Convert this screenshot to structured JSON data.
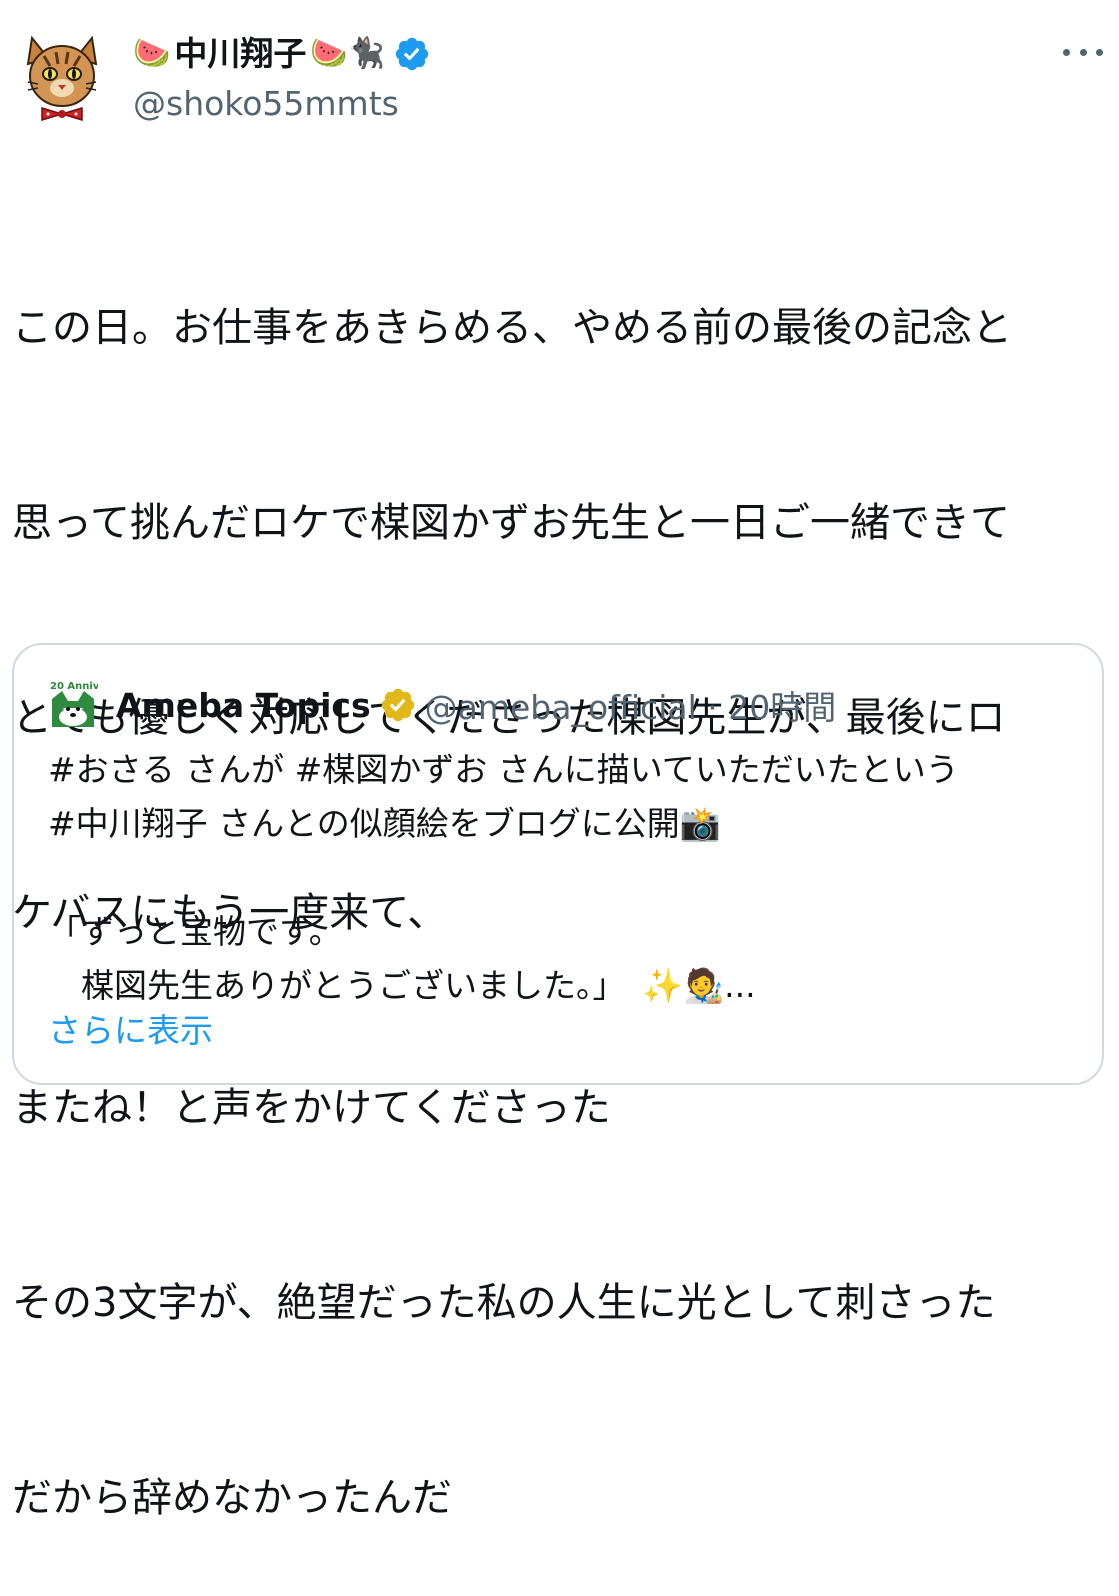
{
  "author": {
    "display_name": "中川翔子",
    "name_prefix_emoji": "🍉",
    "name_suffix_emoji": "🍉🐈‍⬛",
    "handle": "@shoko55mmts",
    "verified_badge_color": "#1d9bf0"
  },
  "tweet": {
    "lines": [
      "この日。お仕事をあきらめる、やめる前の最後の記念と",
      "思って挑んだロケで楳図かずお先生と一日ご一緒できて",
      "とても優しく対応してくださった楳図先生が、最後にロ",
      "ケバスにもう一度来て、",
      "またね！と声をかけてくださった",
      "その3文字が、絶望だった私の人生に光として刺さった",
      "だから辞めなかったんだ"
    ]
  },
  "quote": {
    "display_name": "Ameba Topics",
    "handle_time": "@ameba_official · 20時間",
    "avatar_label": "20 Anniv.",
    "badge_color": "#e2b719",
    "lines": [
      "#おさる さんが #楳図かずお さんに描いていただいたという",
      "#中川翔子 さんとの似顔絵をブログに公開📸",
      "",
      "「ずっと宝物です。",
      "　楳図先生ありがとうございました。」　✨🧑‍🎨..."
    ],
    "show_more": "さらに表示"
  }
}
